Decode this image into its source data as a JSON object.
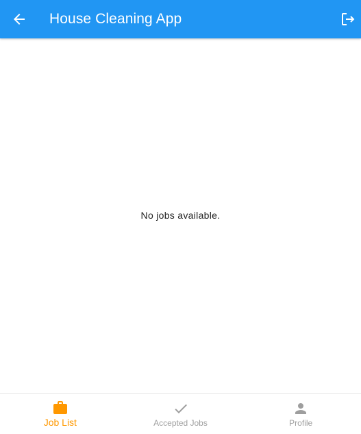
{
  "appbar": {
    "title": "House Cleaning App",
    "back_icon": "arrow-back-icon",
    "logout_icon": "logout-icon",
    "background_color": "#2196f3"
  },
  "main": {
    "empty_message": "No jobs available."
  },
  "bottom_nav": {
    "active_color": "#ff9800",
    "inactive_color": "#9e9e9e",
    "items": [
      {
        "label": "Job List",
        "icon": "briefcase-icon",
        "active": true
      },
      {
        "label": "Accepted Jobs",
        "icon": "check-icon",
        "active": false
      },
      {
        "label": "Profile",
        "icon": "person-icon",
        "active": false
      }
    ]
  }
}
